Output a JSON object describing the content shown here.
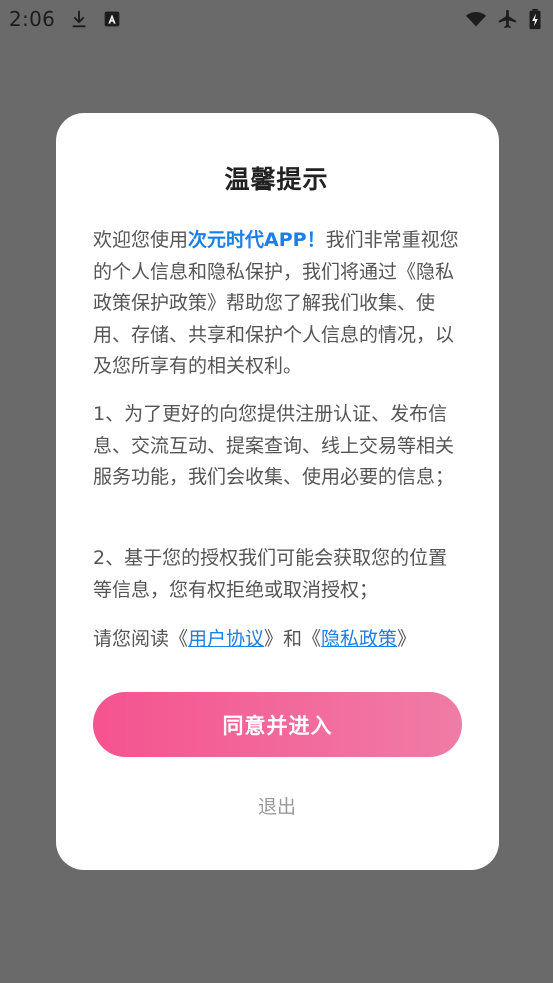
{
  "status_bar": {
    "time": "2:06",
    "icons": [
      "download-icon",
      "a-notification-icon",
      "wifi-icon",
      "airplane-icon",
      "battery-charging-icon"
    ]
  },
  "dialog": {
    "title": "温馨提示",
    "intro": {
      "prefix": "欢迎您使用",
      "app_name": "次元时代APP！",
      "suffix": "我们非常重视您的个人信息和隐私保护，我们将通过《隐私政策保护政策》帮助您了解我们收集、使用、存储、共享和保护个人信息的情况，以及您所享有的相关权利。"
    },
    "point_1": "1、为了更好的向您提供注册认证、发布信息、交流互动、提案查询、线上交易等相关服务功能，我们会收集、使用必要的信息；",
    "point_2": "2、基于您的授权我们可能会获取您的位置等信息，您有权拒绝或取消授权；",
    "read_notice": {
      "prefix": "请您阅读《",
      "user_agreement": "用户协议",
      "middle": "》和《",
      "privacy_policy": "隐私政策",
      "suffix": "》"
    },
    "agree_label": "同意并进入",
    "exit_label": "退出"
  },
  "colors": {
    "accent_blue": "#1a7fe8",
    "button_gradient_start": "#f5538f",
    "button_gradient_end": "#f07ca6",
    "overlay": "#6a6a6a"
  }
}
